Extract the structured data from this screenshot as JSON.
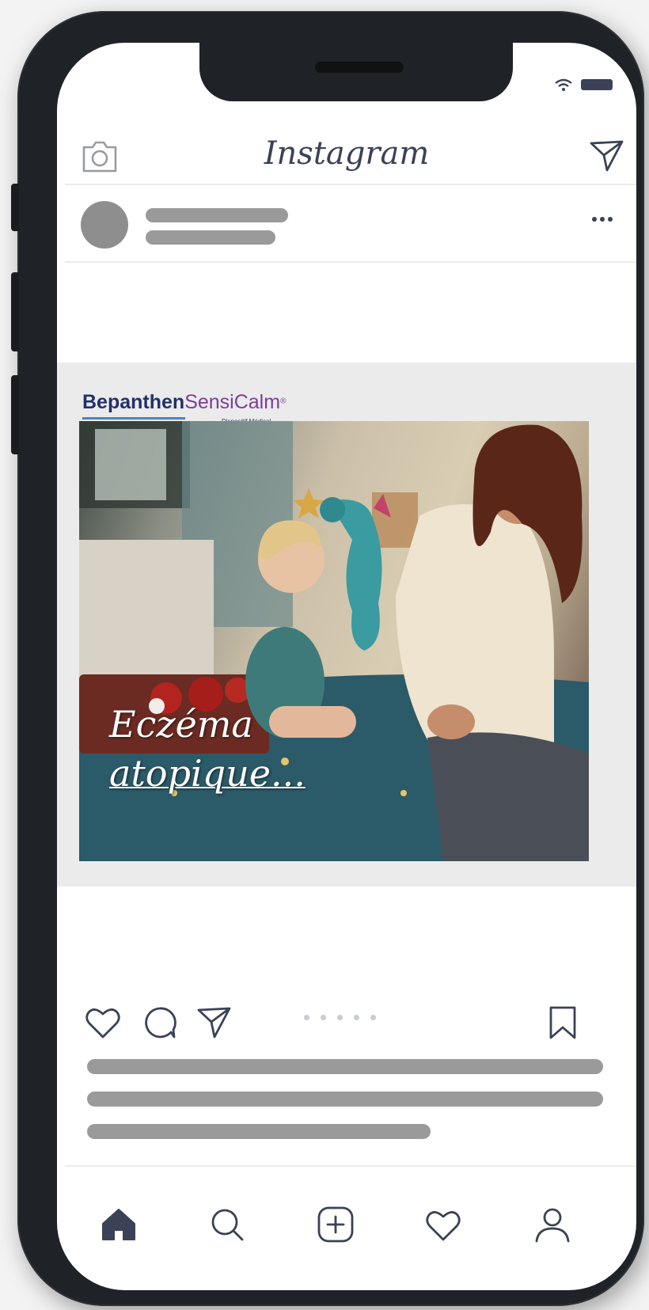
{
  "app": {
    "title": "Instagram"
  },
  "post": {
    "brand": {
      "name": "Bepanthen",
      "product": "SensiCalm",
      "registered": "®",
      "tagline": "Dispositif Médical"
    },
    "caption": {
      "line1": "Eczéma",
      "line2": "atopique..."
    },
    "carousel_dots": 5
  },
  "icons": {
    "header": [
      "camera-icon",
      "send-icon"
    ],
    "post_header": [
      "more-icon"
    ],
    "actions": [
      "heart-icon",
      "comment-icon",
      "share-icon",
      "bookmark-icon"
    ],
    "nav": [
      "home-icon",
      "search-icon",
      "add-post-icon",
      "activity-icon",
      "profile-icon"
    ]
  },
  "colors": {
    "icon": "#3b4257",
    "placeholder": "#9a9a9a",
    "brand_blue": "#22306b",
    "brand_purple": "#7a3e98"
  }
}
